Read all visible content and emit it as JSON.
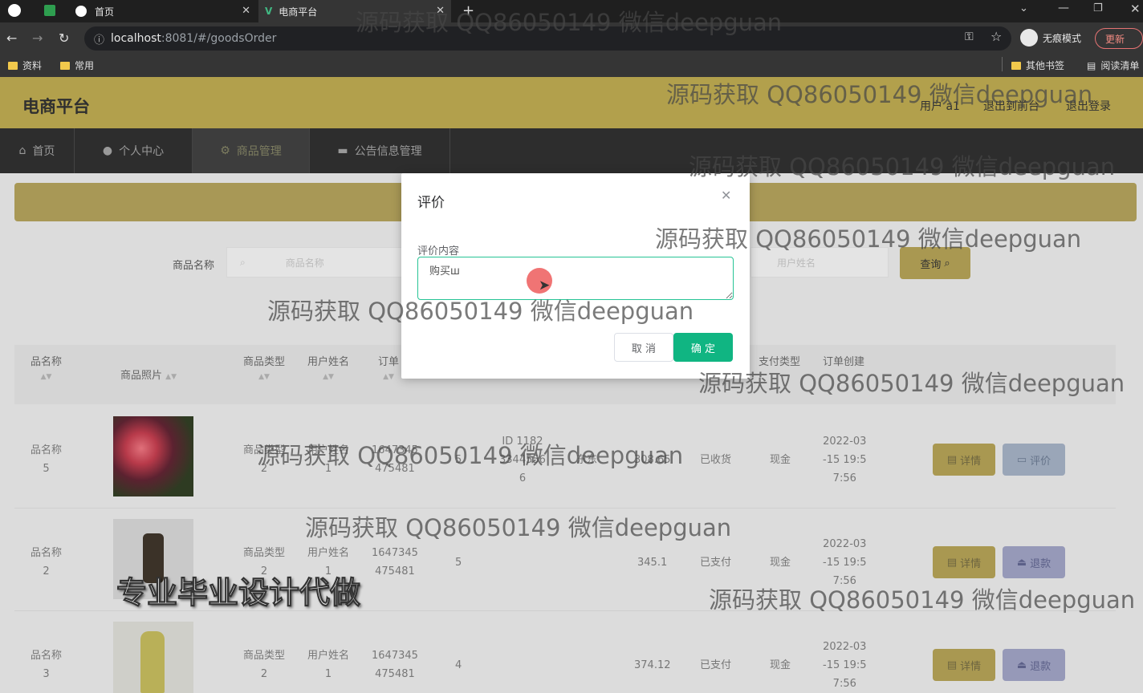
{
  "browser": {
    "tabs": [
      {
        "label": "首页"
      },
      {
        "label": "电商平台"
      }
    ],
    "url_host": "localhost",
    "url_rest": ":8081/#/goodsOrder",
    "incognito_label": "无痕模式",
    "update_label": "更新",
    "bookmarks": [
      "资料",
      "常用"
    ],
    "other_bookmarks": "其他书签",
    "reading_list": "阅读清单"
  },
  "app": {
    "brand": "电商平台",
    "user_label": "用户 a1",
    "back_to_front": "退出到前台",
    "logout": "退出登录"
  },
  "nav": [
    "首页",
    "个人中心",
    "商品管理",
    "公告信息管理"
  ],
  "filters": {
    "goods_name_label": "商品名称",
    "goods_name_placeholder": "商品名称",
    "user_name_placeholder": "用户姓名",
    "query_button": "查询"
  },
  "table": {
    "headers": [
      "品名称",
      "商品照片",
      "商品类型",
      "用户姓名",
      "订单",
      "支付类型",
      "订单创建"
    ],
    "rows": [
      {
        "name": "品名称",
        "name2": "5",
        "type": "商品类型",
        "type2": "2",
        "user": "用户姓名",
        "user2": "1",
        "order": "1647345",
        "order2": "475481",
        "qty": "5",
        "addr1": "ID 1182",
        "addr2": "3344556",
        "addr3": "6",
        "city": "东东",
        "price": "308.65",
        "status": "已收货",
        "pay": "现金",
        "date1": "2022-03",
        "date2": "-15 19:5",
        "date3": "7:56",
        "btn1": "详情",
        "btn2": "评价"
      },
      {
        "name": "品名称",
        "name2": "2",
        "type": "商品类型",
        "type2": "2",
        "user": "用户姓名",
        "user2": "1",
        "order": "1647345",
        "order2": "475481",
        "qty": "5",
        "price": "345.1",
        "status": "已支付",
        "pay": "现金",
        "date1": "2022-03",
        "date2": "-15 19:5",
        "date3": "7:56",
        "btn1": "详情",
        "btn2": "退款"
      },
      {
        "name": "品名称",
        "name2": "3",
        "type": "商品类型",
        "type2": "2",
        "user": "用户姓名",
        "user2": "1",
        "order": "1647345",
        "order2": "475481",
        "qty": "4",
        "price": "374.12",
        "status": "已支付",
        "pay": "现金",
        "date1": "2022-03",
        "date2": "-15 19:5",
        "date3": "7:56",
        "btn1": "详情",
        "btn2": "退款"
      }
    ]
  },
  "modal": {
    "title": "评价",
    "field_label": "评价内容",
    "text_value": "购买ш",
    "cancel": "取 消",
    "confirm": "确 定"
  },
  "overlays": {
    "watermark": "源码获取 QQ86050149 微信deepguan",
    "promo": "专业毕业设计代做"
  }
}
